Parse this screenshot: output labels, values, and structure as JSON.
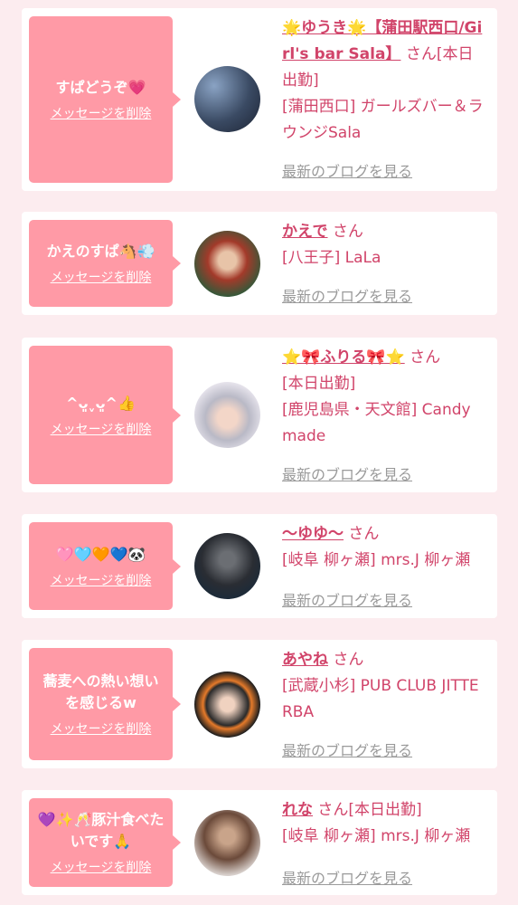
{
  "common": {
    "delete_label": "メッセージを削除",
    "blog_label": "最新のブログを見る",
    "suffix": "さん"
  },
  "items": [
    {
      "message": "すぱどうぞ💗",
      "name": "🌟ゆうき🌟【蒲田駅西口/Girl's bar Sala】",
      "after": "[本日出勤]",
      "shop": "[蒲田西口] ガールズバー＆ラウンジSala"
    },
    {
      "message": "かえのすぱ🐴💨",
      "name": "かえで",
      "after": "",
      "shop": "[八王子] LaLa"
    },
    {
      "message": "^ᴗ͈ˬᴗ͈^👍",
      "name": "⭐🎀ふりる🎀⭐",
      "after": "[本日出勤]",
      "shop": "[鹿児島県・天文館] Candy made"
    },
    {
      "message": "🩷🩵🧡💙🐼",
      "name": "〜ゆゆ〜",
      "after": "",
      "shop": "[岐阜 柳ヶ瀬] mrs.J 柳ヶ瀬"
    },
    {
      "message": "蕎麦への熱い想いを感じるw",
      "name": "あやね",
      "after": "",
      "shop": "[武蔵小杉] PUB CLUB JITTERBA"
    },
    {
      "message": "💜✨🥂豚汁食べたいです🙏",
      "name": "れな",
      "after": "[本日出勤]",
      "shop": "[岐阜 柳ヶ瀬] mrs.J 柳ヶ瀬"
    }
  ]
}
